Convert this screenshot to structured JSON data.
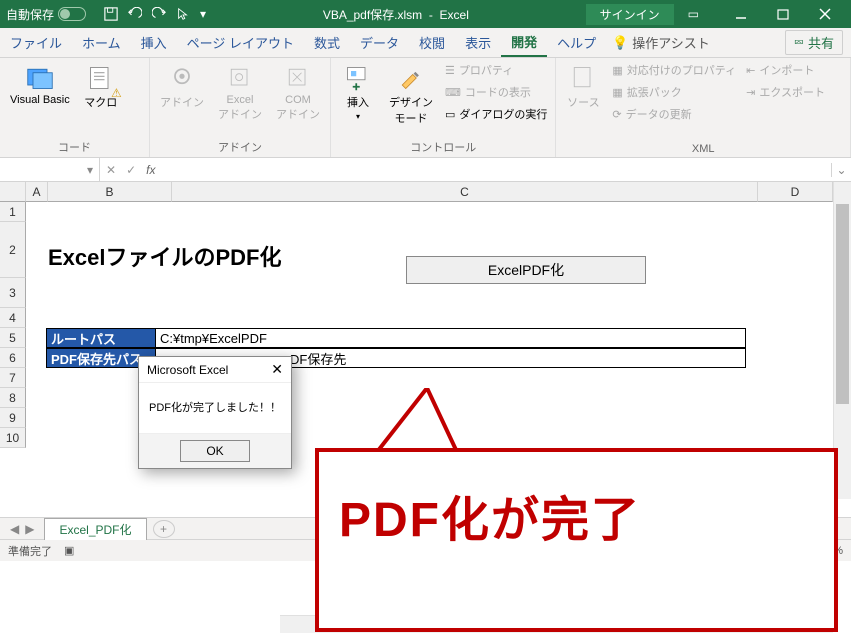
{
  "titlebar": {
    "autosave_label": "自動保存",
    "filename": "VBA_pdf保存.xlsm",
    "app": "Excel",
    "signin": "サインイン"
  },
  "tabs": {
    "file": "ファイル",
    "home": "ホーム",
    "insert": "挿入",
    "pagelayout": "ページ レイアウト",
    "formulas": "数式",
    "data": "データ",
    "review": "校閲",
    "view": "表示",
    "developer": "開発",
    "help": "ヘルプ",
    "assist": "操作アシスト",
    "share": "共有"
  },
  "ribbon": {
    "code": {
      "vb": "Visual Basic",
      "macros": "マクロ",
      "group": "コード"
    },
    "addins": {
      "addin": "アドイン",
      "excel": "Excel\nアドイン",
      "com": "COM\nアドイン",
      "group": "アドイン"
    },
    "controls": {
      "insert": "挿入",
      "design": "デザイン\nモード",
      "props": "プロパティ",
      "viewcode": "コードの表示",
      "rundialog": "ダイアログの実行",
      "group": "コントロール"
    },
    "xml": {
      "source": "ソース",
      "mapprops": "対応付けのプロパティ",
      "expansion": "拡張パック",
      "refresh": "データの更新",
      "import": "インポート",
      "export": "エクスポート",
      "group": "XML"
    }
  },
  "columns": {
    "a": "A",
    "b": "B",
    "c": "C",
    "d": "D"
  },
  "rows": {
    "r1": "1",
    "r2": "2",
    "r3": "3",
    "r4": "4",
    "r5": "5",
    "r6": "6",
    "r7": "7",
    "r8": "8",
    "r9": "9",
    "r10": "10"
  },
  "sheet": {
    "title": "ExcelファイルのPDF化",
    "button": "ExcelPDF化",
    "rootpath_label": "ルートパス",
    "rootpath_value": "C:¥tmp¥ExcelPDF",
    "pdfpath_label": "PDF保存先パス",
    "pdfpath_value_suffix": "DF保存先",
    "tabname": "Excel_PDF化"
  },
  "msgbox": {
    "title": "Microsoft Excel",
    "body": "PDF化が完了しました！！",
    "ok": "OK"
  },
  "callout": {
    "text": "PDF化が完了"
  },
  "status": {
    "ready": "準備完了",
    "zoom": "%"
  }
}
